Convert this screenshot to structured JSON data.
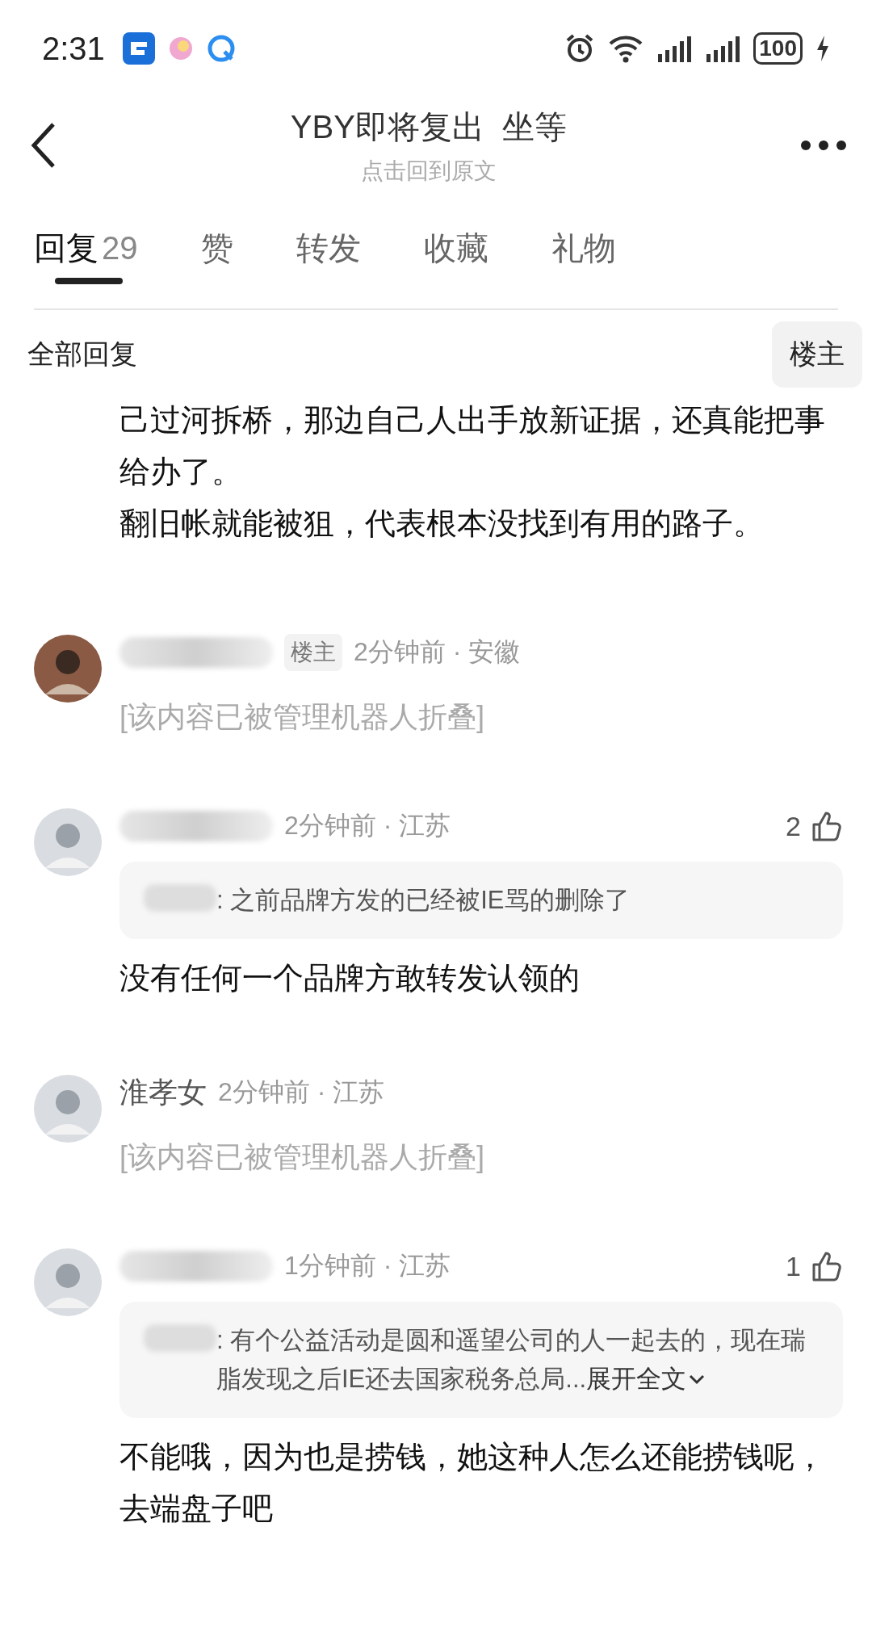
{
  "status_bar": {
    "time": "2:31",
    "battery": "100"
  },
  "header": {
    "title": "YBY即将复出  坐等",
    "subtitle": "点击回到原文"
  },
  "tabs": [
    {
      "label": "回复",
      "count": "29",
      "selected": true
    },
    {
      "label": "赞",
      "selected": false
    },
    {
      "label": "转发",
      "selected": false
    },
    {
      "label": "收藏",
      "selected": false
    },
    {
      "label": "礼物",
      "selected": false
    }
  ],
  "filter": {
    "label": "全部回复",
    "op_button": "楼主"
  },
  "lead_text": [
    "己过河拆桥，那边自己人出手放新证据，还真能把事给办了。",
    "翻旧帐就能被狙，代表根本没找到有用的路子。"
  ],
  "comments": [
    {
      "kind": "folded",
      "badge": "楼主",
      "time": "2分钟前 · 安徽",
      "text": "[该内容已被管理机器人折叠]"
    },
    {
      "kind": "reply",
      "time": "2分钟前 · 江苏",
      "likes": "2",
      "quote": ": 之前品牌方发的已经被IE骂的删除了",
      "text": "没有任何一个品牌方敢转发认领的"
    },
    {
      "kind": "folded",
      "name": "淮孝女",
      "time": "2分钟前 · 江苏",
      "text": "[该内容已被管理机器人折叠]"
    },
    {
      "kind": "reply",
      "time": "1分钟前 · 江苏",
      "likes": "1",
      "quote": ": 有个公益活动是圆和遥望公司的人一起去的，现在瑞脂发现之后IE还去国家税务总局...",
      "expand": "展开全文",
      "text": "不能哦，因为也是捞钱，她这种人怎么还能捞钱呢，去端盘子吧"
    }
  ]
}
